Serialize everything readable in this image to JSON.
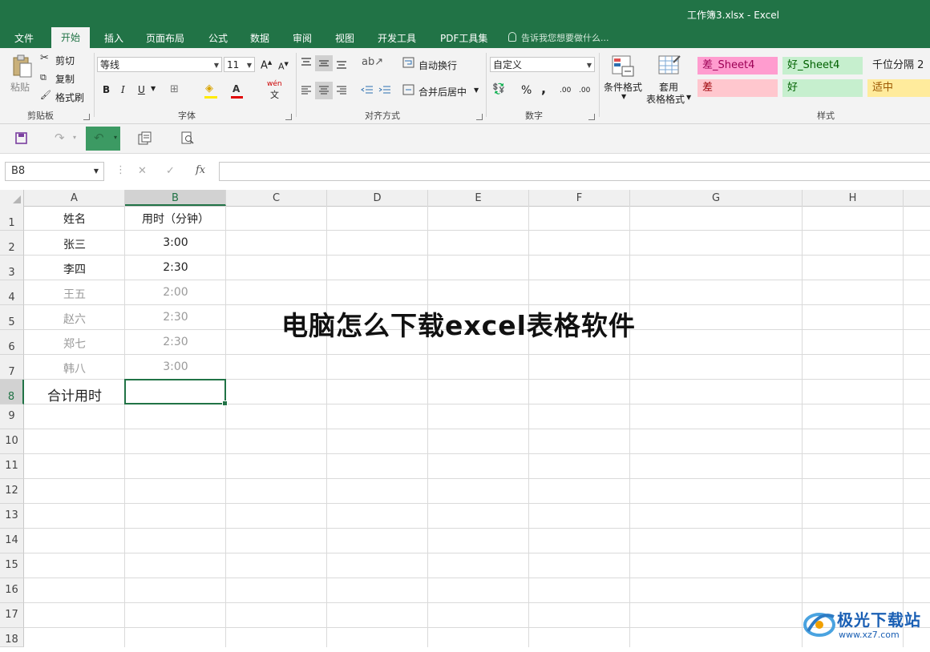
{
  "app": {
    "window_title": "工作簿3.xlsx - Excel"
  },
  "tabs": [
    "文件",
    "开始",
    "插入",
    "页面布局",
    "公式",
    "数据",
    "审阅",
    "视图",
    "开发工具",
    "PDF工具集"
  ],
  "active_tab": "开始",
  "tell_me": "告诉我您想要做什么...",
  "ribbon": {
    "clipboard": {
      "paste": "粘贴",
      "cut": "剪切",
      "copy": "复制",
      "format_painter": "格式刷",
      "group_label": "剪贴板"
    },
    "font": {
      "name": "等线",
      "size": "11",
      "bold": "B",
      "italic": "I",
      "underline": "U",
      "wen": "wén",
      "wen_char": "文",
      "group_label": "字体"
    },
    "alignment": {
      "wrap_text": "自动换行",
      "merge_center": "合并后居中",
      "group_label": "对齐方式"
    },
    "number": {
      "format": "自定义",
      "percent": "%",
      "comma": ",",
      "inc_dec": ".00",
      "group_label": "数字"
    },
    "styles": {
      "conditional": "条件格式",
      "table_format_1": "套用",
      "table_format_2": "表格格式",
      "group_label": "样式",
      "cells": [
        {
          "label": "差_Sheet4",
          "bg": "#ff9ccf",
          "fg": "#9c0055"
        },
        {
          "label": "好_Sheet4",
          "bg": "#c6efce",
          "fg": "#006100"
        },
        {
          "label": "千位分隔 2",
          "bg": "#f3f3f3",
          "fg": "#222222"
        },
        {
          "label": "差",
          "bg": "#ffc7ce",
          "fg": "#9c0006"
        },
        {
          "label": "好",
          "bg": "#c6efce",
          "fg": "#006100"
        },
        {
          "label": "适中",
          "bg": "#ffeb9c",
          "fg": "#9c5700"
        }
      ]
    }
  },
  "formula_bar": {
    "name_box": "B8",
    "fx": "fx",
    "cancel": "✕",
    "enter": "✓"
  },
  "sheet": {
    "columns": [
      "A",
      "B",
      "C",
      "D",
      "E",
      "F",
      "G",
      "H"
    ],
    "selected_column": "B",
    "rows": [
      "1",
      "2",
      "3",
      "4",
      "5",
      "6",
      "7",
      "8",
      "9",
      "10",
      "11",
      "12",
      "13",
      "14",
      "15",
      "16",
      "17",
      "18"
    ],
    "selected_row": "8",
    "cells": [
      [
        "姓名",
        "用时（分钟）"
      ],
      [
        "张三",
        "3:00"
      ],
      [
        "李四",
        "2:30"
      ],
      [
        "王五",
        "2:00"
      ],
      [
        "赵六",
        "2:30"
      ],
      [
        "郑七",
        "2:30"
      ],
      [
        "韩八",
        "3:00"
      ],
      [
        "合计用时",
        ""
      ]
    ]
  },
  "overlay": {
    "headline": "电脑怎么下载excel表格软件"
  },
  "watermark": {
    "brand": "极光下载站",
    "url": "www.xz7.com"
  },
  "colors": {
    "excel_green": "#217346",
    "ribbon_bg": "#f3f3f3"
  }
}
